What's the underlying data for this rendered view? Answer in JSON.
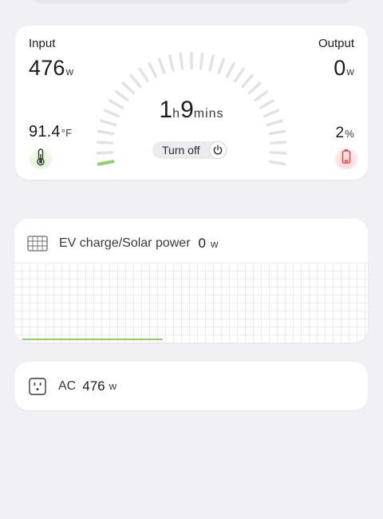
{
  "status": {
    "input_label": "Input",
    "input_value": "476",
    "input_unit": "w",
    "output_label": "Output",
    "output_value": "0",
    "output_unit": "w",
    "temperature_value": "91.4",
    "temperature_unit": "°F",
    "battery_value": "2",
    "battery_unit": "%",
    "battery_level": 0.02,
    "time_hours": "1",
    "time_hours_unit": "h",
    "time_minutes": "9",
    "time_minutes_unit": "mins",
    "turn_off_label": "Turn off"
  },
  "colors": {
    "accent_green": "#8fd16d",
    "battery_red": "#e04848",
    "tick_grey": "#e2e2e6"
  },
  "panel": {
    "title": "EV charge/Solar power",
    "value": "0",
    "unit": "w"
  },
  "ac": {
    "label": "AC",
    "value": "476",
    "unit": "w"
  },
  "icons": {
    "panel": "solar-panel-icon",
    "thermometer": "thermometer-icon",
    "battery": "battery-low-icon",
    "power": "power-icon",
    "outlet": "ac-outlet-icon"
  }
}
